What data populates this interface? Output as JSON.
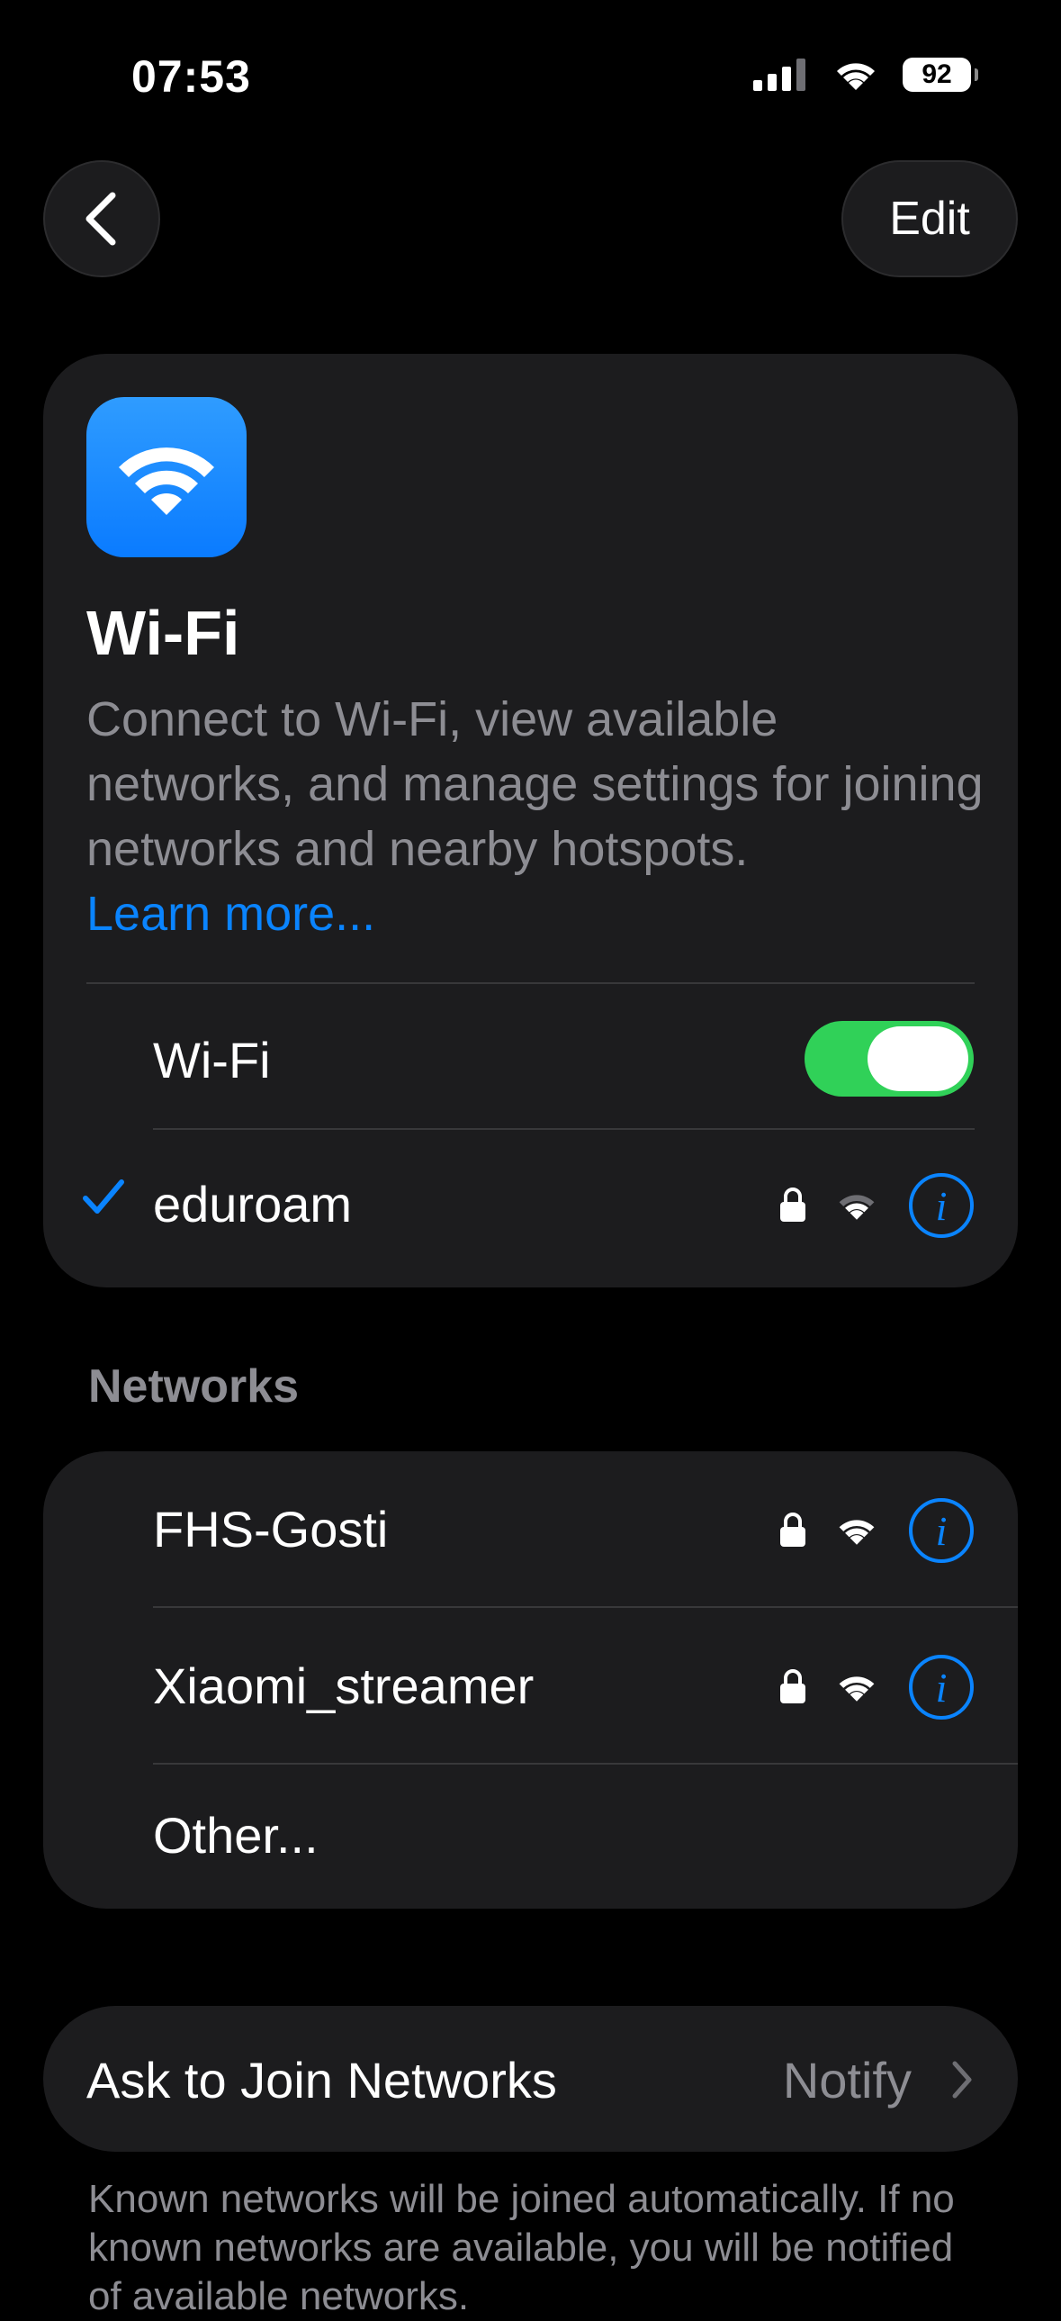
{
  "status_bar": {
    "time": "07:53",
    "battery": "92",
    "icons": [
      "cellular-signal-icon",
      "wifi-status-icon",
      "battery-icon"
    ]
  },
  "nav": {
    "back_icon": "chevron-left-icon",
    "edit_label": "Edit"
  },
  "wifi_card": {
    "title": "Wi-Fi",
    "description": "Connect to Wi-Fi, view available networks, and manage settings for joining networks and nearby hotspots.",
    "learn_more": "Learn more...",
    "toggle_label": "Wi-Fi",
    "toggle_on": true,
    "connected_network": "eduroam"
  },
  "networks_section": {
    "header": "Networks",
    "items": [
      {
        "name": "FHS-Gosti"
      },
      {
        "name": "Xiaomi_streamer"
      },
      {
        "name": "Other..."
      }
    ]
  },
  "ask_to_join": {
    "label": "Ask to Join Networks",
    "value": "Notify",
    "footer": "Known networks will be joined automatically. If no known networks are available, you will be notified of available networks."
  },
  "colors": {
    "accent": "#0a84ff",
    "toggle_on": "#30d158",
    "card_bg": "#1c1c1e",
    "secondary_text": "#8d8d93"
  }
}
